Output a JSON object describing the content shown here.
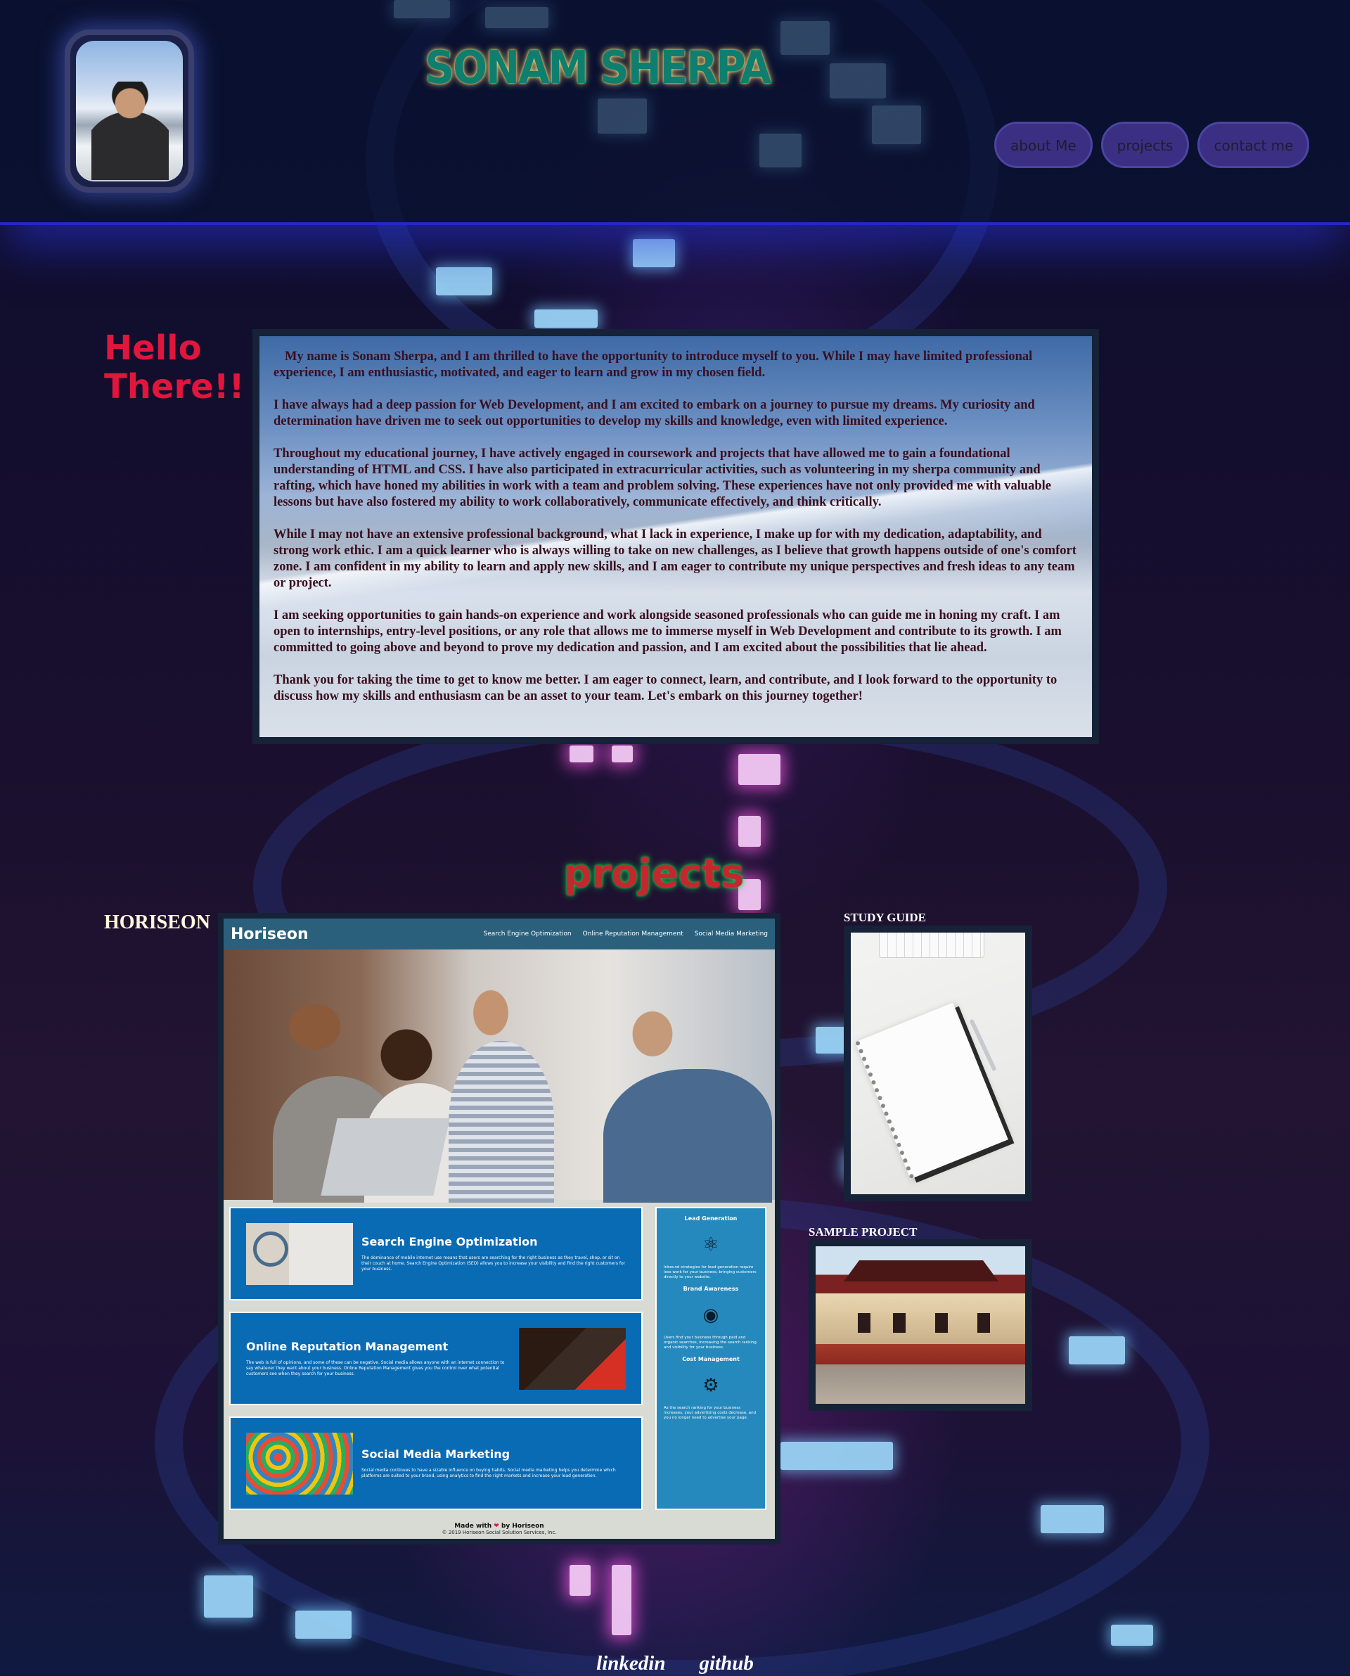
{
  "header": {
    "site_title": "SONAM SHERPA",
    "nav": [
      {
        "label": "about Me"
      },
      {
        "label": "projects"
      },
      {
        "label": "contact me"
      }
    ]
  },
  "about": {
    "greeting": "Hello There!!",
    "paragraphs": [
      "My name is Sonam Sherpa, and I am thrilled to have the opportunity to introduce myself to you. While I may have limited professional experience, I am enthusiastic, motivated, and eager to learn and grow in my chosen field.",
      "I have always had a deep passion for Web Development, and I am excited to embark on a journey to pursue my dreams. My curiosity and determination have driven me to seek out opportunities to develop my skills and knowledge, even with limited experience.",
      "Throughout my educational journey, I have actively engaged in coursework and projects that have allowed me to gain a foundational understanding of HTML and CSS. I have also participated in extracurricular activities, such as volunteering in my sherpa community and rafting, which have honed my abilities in work with a team and problem solving. These experiences have not only provided me with valuable lessons but have also fostered my ability to work collaboratively, communicate effectively, and think critically.",
      "While I may not have an extensive professional background, what I lack in experience, I make up for with my dedication, adaptability, and strong work ethic. I am a quick learner who is always willing to take on new challenges, as I believe that growth happens outside of one's comfort zone. I am confident in my ability to learn and apply new skills, and I am eager to contribute my unique perspectives and fresh ideas to any team or project.",
      "I am seeking opportunities to gain hands-on experience and work alongside seasoned professionals who can guide me in honing my craft. I am open to internships, entry-level positions, or any role that allows me to immerse myself in Web Development and contribute to its growth. I am committed to going above and beyond to prove my dedication and passion, and I am excited about the possibilities that lie ahead.",
      "Thank you for taking the time to get to know me better. I am eager to connect, learn, and contribute, and I look forward to the opportunity to discuss how my skills and enthusiasm can be an asset to your team. Let's embark on this journey together!"
    ]
  },
  "projects": {
    "heading": "projects",
    "items": [
      {
        "label": "HORISEON"
      },
      {
        "label": "STUDY GUIDE"
      },
      {
        "label": "SAMPLE PROJECT"
      }
    ],
    "horiseon_preview": {
      "logo": "Horiseon",
      "nav": [
        "Search Engine Optimization",
        "Online Reputation Management",
        "Social Media Marketing"
      ],
      "cards": [
        {
          "title": "Search Engine Optimization",
          "text": "The dominance of mobile internet use means that users are searching for the right business as they travel, shop, or sit on their couch at home. Search Engine Optimization (SEO) allows you to increase your visibility and find the right customers for your business."
        },
        {
          "title": "Online Reputation Management",
          "text": "The web is full of opinions, and some of these can be negative. Social media allows anyone with an internet connection to say whatever they want about your business. Online Reputation Management gives you the control over what potential customers see when they search for your business."
        },
        {
          "title": "Social Media Marketing",
          "text": "Social media continues to have a sizable influence on buying habits. Social media marketing helps you determine which platforms are suited to your brand, using analytics to find the right markets and increase your lead generation."
        }
      ],
      "sidebar": [
        {
          "title": "Lead Generation",
          "text": "Inbound strategies for lead generation require less work for your business, bringing customers directly to your website."
        },
        {
          "title": "Brand Awareness",
          "text": "Users find your business through paid and organic searches, increasing the search ranking and visibility for your business."
        },
        {
          "title": "Cost Management",
          "text": "As the search ranking for your business increases, your advertising costs decrease, and you no longer need to advertise your page."
        }
      ],
      "footer_made": "Made with",
      "footer_by": "by Horiseon",
      "footer_copy": "© 2019 Horiseon Social Solution Services, Inc."
    }
  },
  "footer": {
    "links": [
      {
        "label": "linkedin"
      },
      {
        "label": "github"
      }
    ]
  }
}
